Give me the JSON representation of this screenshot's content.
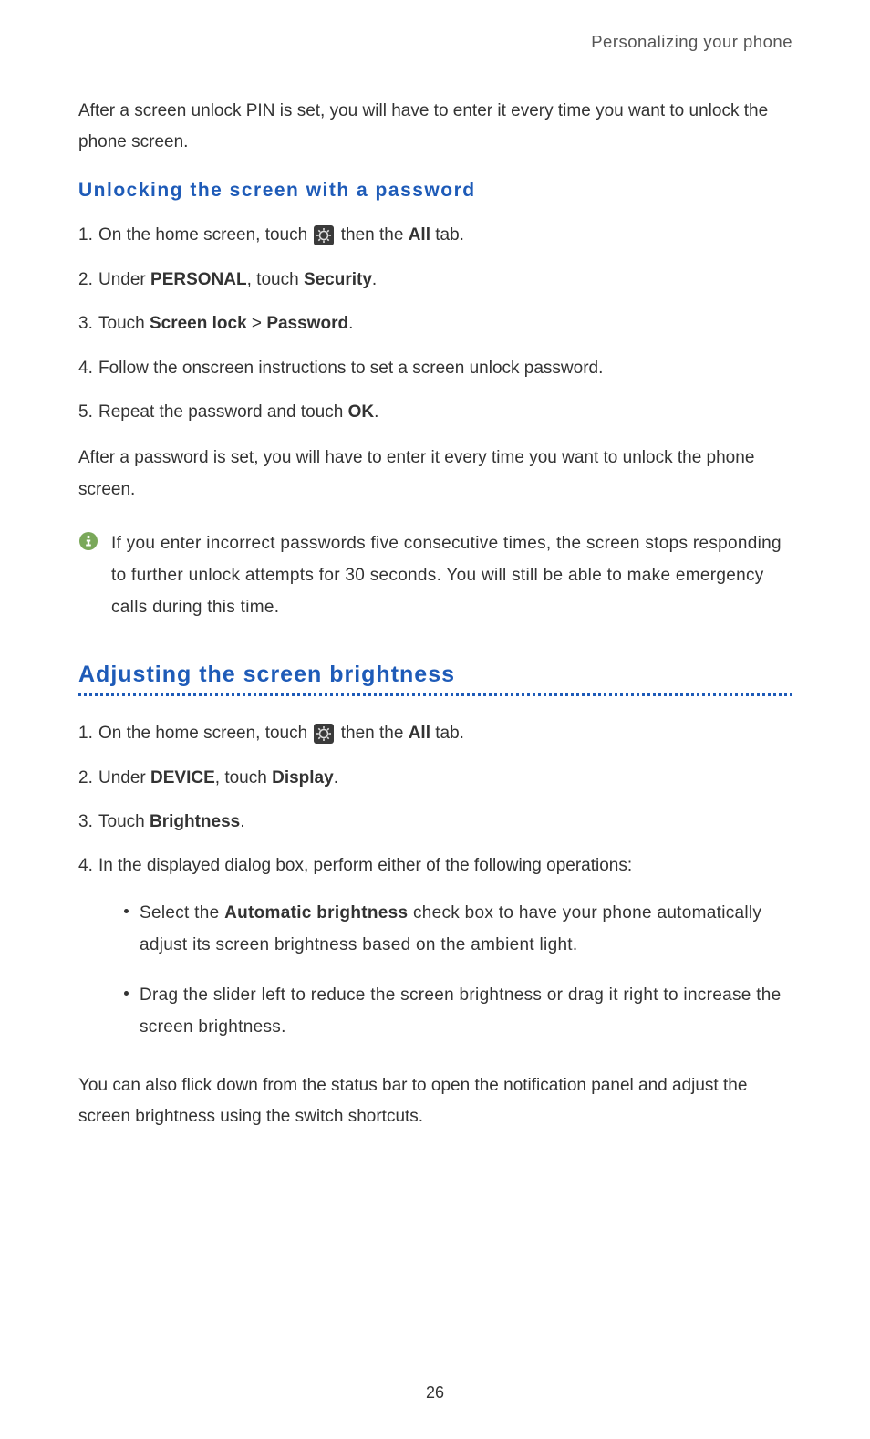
{
  "header": "Personalizing your phone",
  "intro_pin": "After a screen unlock PIN is set, you will have to enter it every time you want to unlock the phone screen.",
  "section1": {
    "heading": "Unlocking the screen with a password",
    "step1_pre": "On the home screen, touch ",
    "step1_post_a": " then the ",
    "step1_bold": "All",
    "step1_post_b": " tab.",
    "step2_a": "Under ",
    "step2_b": "PERSONAL",
    "step2_c": ", touch ",
    "step2_d": "Security",
    "step2_e": ".",
    "step3_a": "Touch ",
    "step3_b": "Screen lock",
    "step3_c": " > ",
    "step3_d": "Password",
    "step3_e": ".",
    "step4": "Follow the onscreen instructions to set a screen unlock password.",
    "step5_a": "Repeat the password and touch ",
    "step5_b": "OK",
    "step5_c": ".",
    "after_password": "After a password is set, you will have to enter it every time you want to unlock the phone screen.",
    "info": "If you enter incorrect passwords five consecutive times, the screen stops responding to further unlock attempts for 30 seconds. You will still be able to make emergency calls during this time."
  },
  "section2": {
    "heading": "Adjusting the screen brightness",
    "step1_pre": "On the home screen, touch ",
    "step1_post_a": " then the ",
    "step1_bold": "All",
    "step1_post_b": " tab.",
    "step2_a": "Under ",
    "step2_b": "DEVICE",
    "step2_c": ", touch ",
    "step2_d": "Display",
    "step2_e": ".",
    "step3_a": "Touch ",
    "step3_b": "Brightness",
    "step3_c": ".",
    "step4": "In the displayed dialog box, perform either of the following operations:",
    "bullet1_a": "Select the ",
    "bullet1_b": "Automatic brightness",
    "bullet1_c": " check box to have your phone automatically adjust its screen brightness based on the ambient light.",
    "bullet2": "Drag the slider left to reduce the screen brightness or drag it right to increase the screen brightness.",
    "after": "You can also flick down from the status bar to open the notification panel and adjust the screen brightness using the switch shortcuts."
  },
  "page_number": "26",
  "numbers": {
    "n1": "1.",
    "n2": "2.",
    "n3": "3.",
    "n4": "4.",
    "n5": "5."
  }
}
